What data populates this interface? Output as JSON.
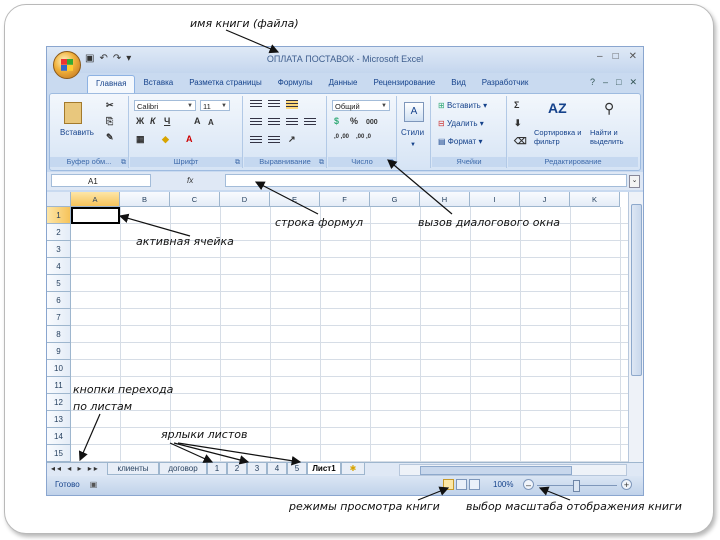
{
  "window": {
    "title": "ОПЛАТА ПОСТАВОК - Microsoft Excel"
  },
  "ribbon_tabs": [
    "Главная",
    "Вставка",
    "Разметка страницы",
    "Формулы",
    "Данные",
    "Рецензирование",
    "Вид",
    "Разработчик"
  ],
  "ribbon": {
    "clipboard": {
      "paste_label": "Вставить",
      "group_label": "Буфер обм..."
    },
    "font": {
      "font_name": "Calibri",
      "font_size": "11",
      "bold": "Ж",
      "italic": "К",
      "underline": "Ч",
      "grow": "A",
      "shrink": "A",
      "group_label": "Шрифт"
    },
    "alignment": {
      "group_label": "Выравнивание"
    },
    "number": {
      "format": "Общий",
      "percent": "%",
      "thousands": "000",
      "inc_decimal": ",0 ,00",
      "dec_decimal": ",00 ,0",
      "group_label": "Число"
    },
    "styles": {
      "label": "Стили"
    },
    "cells": {
      "insert": "Вставить",
      "delete": "Удалить",
      "format": "Формат",
      "group_label": "Ячейки"
    },
    "editing": {
      "sum": "Σ",
      "sort": "Сортировка и фильтр",
      "find": "Найти и выделить",
      "group_label": "Редактирование"
    }
  },
  "formula_bar": {
    "cell_ref": "A1",
    "fx": "fx"
  },
  "columns": [
    "A",
    "B",
    "C",
    "D",
    "E",
    "F",
    "G",
    "H",
    "I",
    "J",
    "K"
  ],
  "rows": [
    "1",
    "2",
    "3",
    "4",
    "5",
    "6",
    "7",
    "8",
    "9",
    "10",
    "11",
    "12",
    "13",
    "14",
    "15"
  ],
  "sheet_tabs": [
    "клиенты",
    "договор",
    "1",
    "2",
    "3",
    "4",
    "5",
    "Лист1"
  ],
  "active_sheet": "Лист1",
  "status": {
    "ready": "Готово",
    "zoom": "100%"
  },
  "annotations": {
    "file_name": "имя книги (файла)",
    "formula_bar": "строка формул",
    "dialog_launcher": "вызов диалогового окна",
    "active_cell": "активная ячейка",
    "sheet_nav_1": "кнопки перехода",
    "sheet_nav_2": "по листам",
    "sheet_tabs": "ярлыки листов",
    "view_modes": "режимы просмотра книги",
    "zoom": "выбор масштаба отображения книги"
  }
}
